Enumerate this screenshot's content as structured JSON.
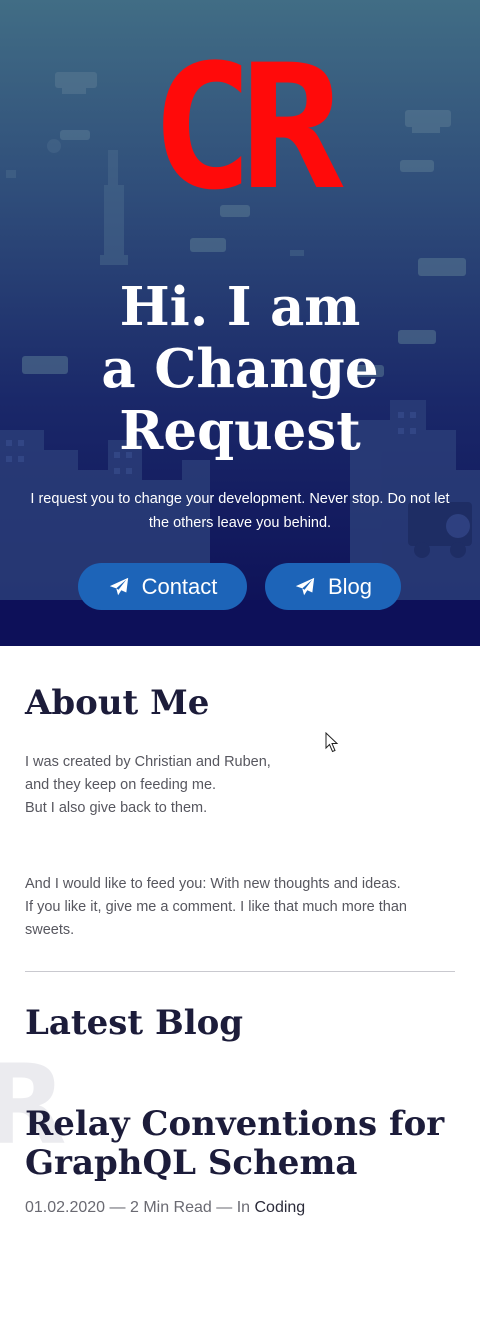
{
  "theme": {
    "logo_color": "#ff0a0a",
    "hero_gradient_top": "#416d85",
    "hero_gradient_bottom": "#0c0e55",
    "button_color": "#1d64b8",
    "heading_color": "#1c1c3a"
  },
  "hero": {
    "logo_text": "CR",
    "title_line1": "Hi. I am",
    "title_line2": "a Change",
    "title_line3": "Request",
    "subtitle": "I request you to change your development. Never stop. Do not let the others leave you behind.",
    "buttons": [
      {
        "label": "Contact",
        "icon": "paper-plane-icon"
      },
      {
        "label": "Blog",
        "icon": "paper-plane-icon"
      }
    ]
  },
  "about": {
    "title": "About Me",
    "paragraph1_lines": [
      "I was created by Christian and Ruben,",
      "and they keep on feeding me.",
      "But I also give back to them."
    ],
    "paragraph2_lines": [
      "And I would like to feed you: With new thoughts and ideas.",
      "If you like it, give me a comment. I like that much more than",
      "sweets."
    ]
  },
  "blog": {
    "title": "Latest Blog",
    "ghost_letter": "R",
    "post": {
      "title": "Relay Conventions for GraphQL Schema",
      "date": "01.02.2020",
      "separator1": " — ",
      "read_time": "2 Min Read",
      "separator2": " — ",
      "in_label": "In ",
      "category": "Coding"
    }
  }
}
